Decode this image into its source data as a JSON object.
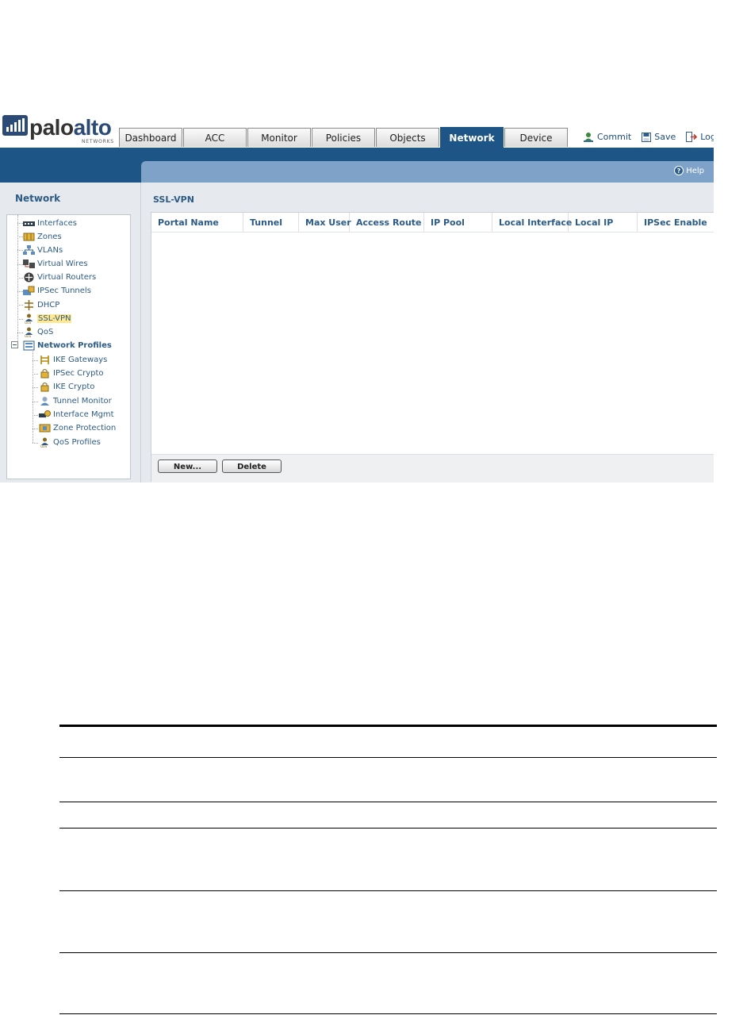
{
  "header": {
    "logo_text_1": "palo",
    "logo_text_2": "alto",
    "logo_sub": "NETWORKS",
    "tabs": [
      {
        "label": "Dashboard",
        "active": false
      },
      {
        "label": "ACC",
        "active": false
      },
      {
        "label": "Monitor",
        "active": false
      },
      {
        "label": "Policies",
        "active": false
      },
      {
        "label": "Objects",
        "active": false
      },
      {
        "label": "Network",
        "active": true
      },
      {
        "label": "Device",
        "active": false
      }
    ],
    "actions": [
      {
        "label": "Commit",
        "icon": "commit-icon"
      },
      {
        "label": "Save",
        "icon": "save-icon"
      },
      {
        "label": "Logou",
        "icon": "logout-icon"
      }
    ],
    "help_label": "Help"
  },
  "sidebar": {
    "title": "Network",
    "items": [
      {
        "label": "Interfaces",
        "icon": "interfaces-icon",
        "selected": false,
        "bold": false
      },
      {
        "label": "Zones",
        "icon": "zones-icon",
        "selected": false,
        "bold": false
      },
      {
        "label": "VLANs",
        "icon": "vlans-icon",
        "selected": false,
        "bold": false
      },
      {
        "label": "Virtual Wires",
        "icon": "virtual-wires-icon",
        "selected": false,
        "bold": false
      },
      {
        "label": "Virtual Routers",
        "icon": "virtual-routers-icon",
        "selected": false,
        "bold": false
      },
      {
        "label": "IPSec Tunnels",
        "icon": "ipsec-tunnels-icon",
        "selected": false,
        "bold": false
      },
      {
        "label": "DHCP",
        "icon": "dhcp-icon",
        "selected": false,
        "bold": false
      },
      {
        "label": "SSL-VPN",
        "icon": "ssl-vpn-icon",
        "selected": true,
        "bold": false
      },
      {
        "label": "QoS",
        "icon": "qos-icon",
        "selected": false,
        "bold": false
      },
      {
        "label": "Network Profiles",
        "icon": "network-profiles-icon",
        "selected": false,
        "bold": true
      },
      {
        "label": "IKE Gateways",
        "icon": "ike-gateways-icon",
        "selected": false,
        "bold": false
      },
      {
        "label": "IPSec Crypto",
        "icon": "ipsec-crypto-icon",
        "selected": false,
        "bold": false
      },
      {
        "label": "IKE Crypto",
        "icon": "ike-crypto-icon",
        "selected": false,
        "bold": false
      },
      {
        "label": "Tunnel Monitor",
        "icon": "tunnel-monitor-icon",
        "selected": false,
        "bold": false
      },
      {
        "label": "Interface Mgmt",
        "icon": "interface-mgmt-icon",
        "selected": false,
        "bold": false
      },
      {
        "label": "Zone Protection",
        "icon": "zone-protection-icon",
        "selected": false,
        "bold": false
      },
      {
        "label": "QoS Profiles",
        "icon": "qos-profiles-icon",
        "selected": false,
        "bold": false
      }
    ]
  },
  "main": {
    "title": "SSL-VPN",
    "columns": [
      "Portal Name",
      "Tunnel",
      "Max User",
      "Access Route",
      "IP Pool",
      "Local Interface",
      "Local IP",
      "IPSec Enable"
    ],
    "rows": [],
    "buttons": {
      "new_label": "New...",
      "delete_label": "Delete"
    }
  },
  "colors": {
    "brand_blue": "#1d5586",
    "help_bar": "#7fa2c9",
    "selected_highlight": "#ffe88f",
    "link_text": "#2c5b85"
  }
}
